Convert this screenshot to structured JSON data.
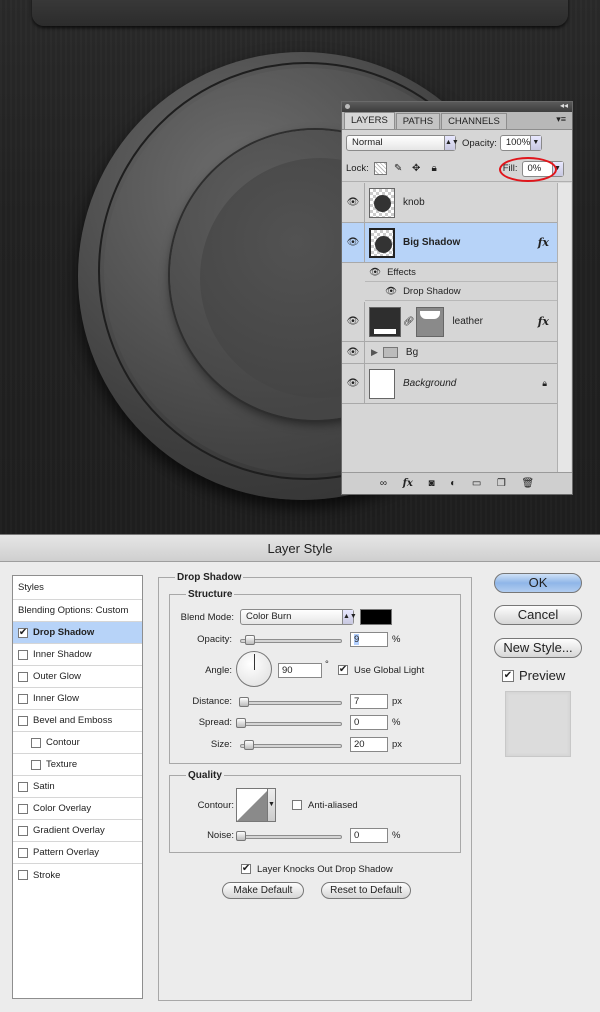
{
  "layers_panel": {
    "tabs": [
      "LAYERS",
      "PATHS",
      "CHANNELS"
    ],
    "blend_mode": "Normal",
    "opacity_label": "Opacity:",
    "opacity_value": "100%",
    "lock_label": "Lock:",
    "fill_label": "Fill:",
    "fill_value": "0%",
    "layers": [
      {
        "name": "knob"
      },
      {
        "name": "Big Shadow",
        "fx": "fx"
      },
      {
        "effects_label": "Effects",
        "effect": "Drop Shadow"
      },
      {
        "name": "leather",
        "fx": "fx"
      },
      {
        "name": "Bg"
      },
      {
        "name": "Background"
      }
    ]
  },
  "dialog": {
    "title": "Layer Style",
    "styles_header": "Styles",
    "blending_options": "Blending Options: Custom",
    "style_items": [
      {
        "label": "Drop Shadow",
        "checked": true
      },
      {
        "label": "Inner Shadow",
        "checked": false
      },
      {
        "label": "Outer Glow",
        "checked": false
      },
      {
        "label": "Inner Glow",
        "checked": false
      },
      {
        "label": "Bevel and Emboss",
        "checked": false
      },
      {
        "label": "Contour",
        "checked": false
      },
      {
        "label": "Texture",
        "checked": false
      },
      {
        "label": "Satin",
        "checked": false
      },
      {
        "label": "Color Overlay",
        "checked": false
      },
      {
        "label": "Gradient Overlay",
        "checked": false
      },
      {
        "label": "Pattern Overlay",
        "checked": false
      },
      {
        "label": "Stroke",
        "checked": false
      }
    ],
    "section_title": "Drop Shadow",
    "structure": {
      "title": "Structure",
      "blend_mode_label": "Blend Mode:",
      "blend_mode": "Color Burn",
      "shadow_color": "#000000",
      "opacity_label": "Opacity:",
      "opacity": "9",
      "opacity_pct": 9,
      "angle_label": "Angle:",
      "angle": "90",
      "use_global_light": "Use Global Light",
      "distance_label": "Distance:",
      "distance": "7",
      "distance_pct": 3,
      "spread_label": "Spread:",
      "spread": "0",
      "spread_pct": 0,
      "size_label": "Size:",
      "size": "20",
      "size_pct": 8,
      "unit_pct": "%",
      "unit_px": "px",
      "degree": "°"
    },
    "quality": {
      "title": "Quality",
      "contour_label": "Contour:",
      "anti_aliased": "Anti-aliased",
      "noise_label": "Noise:",
      "noise": "0",
      "noise_pct": 0
    },
    "knockout": "Layer Knocks Out Drop Shadow",
    "make_default": "Make Default",
    "reset_default": "Reset to Default",
    "buttons": {
      "ok": "OK",
      "cancel": "Cancel",
      "new_style": "New Style...",
      "preview": "Preview"
    }
  }
}
